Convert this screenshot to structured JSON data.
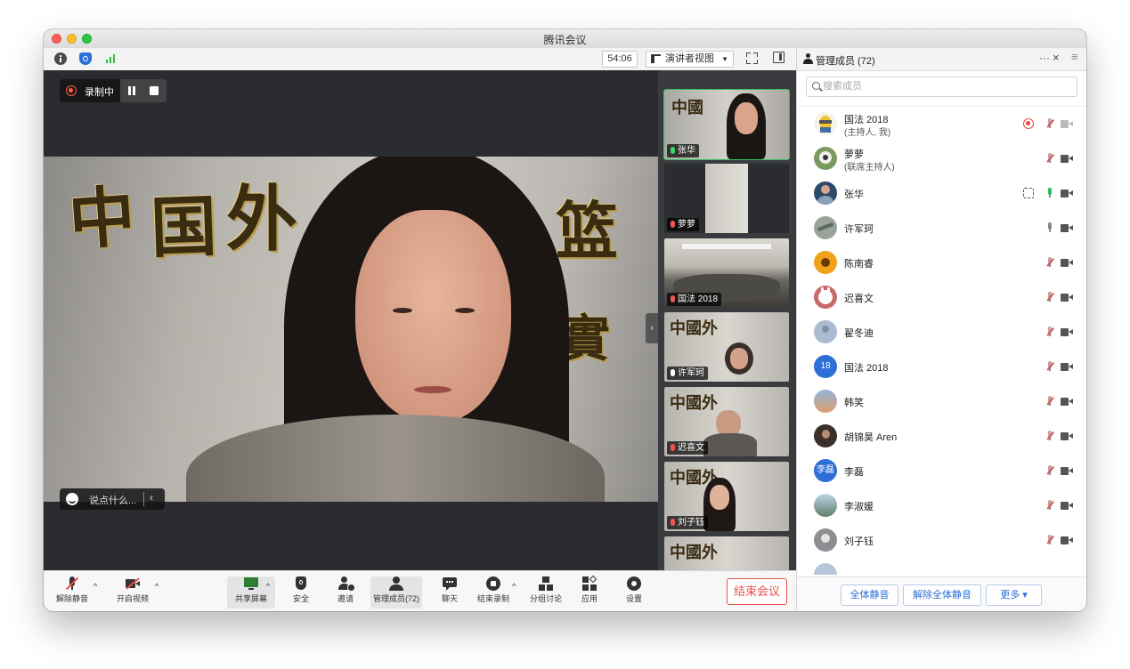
{
  "window": {
    "title": "腾讯会议"
  },
  "toolbar": {
    "timer": "54:06",
    "view_label": "演讲者视图",
    "view_caret": "▼"
  },
  "recording": {
    "label": "录制中"
  },
  "chat": {
    "placeholder": "说点什么...",
    "collapse_glyph": "‹"
  },
  "gallery": {
    "collapse_glyph": "›",
    "tiles": [
      {
        "name": "张华"
      },
      {
        "name": "萝萝"
      },
      {
        "name": "国法 2018"
      },
      {
        "name": "许军珂"
      },
      {
        "name": "迟喜文"
      },
      {
        "name": "刘子钰"
      }
    ]
  },
  "bottombar": {
    "unmute": "解除静音",
    "start_video": "开启视频",
    "share_screen": "共享屏幕",
    "security": "安全",
    "invite": "邀请",
    "manage_members": "管理成员(72)",
    "chat": "聊天",
    "end_record": "结束录制",
    "breakout": "分组讨论",
    "apps": "应用",
    "settings": "设置",
    "end_meeting": "结束会议",
    "caret": "^"
  },
  "panel": {
    "title": "管理成员 (72)",
    "more": "···",
    "close": "×",
    "menu": "≡",
    "search_placeholder": "搜索成员",
    "members": [
      {
        "name": "国法 2018",
        "role": "(主持人, 我)"
      },
      {
        "name": "萝萝",
        "role": "(联席主持人)"
      },
      {
        "name": "张华",
        "role": ""
      },
      {
        "name": "许军珂",
        "role": ""
      },
      {
        "name": "陈南睿",
        "role": ""
      },
      {
        "name": "迟喜文",
        "role": ""
      },
      {
        "name": "翟冬迪",
        "role": ""
      },
      {
        "name": "国法 2018",
        "role": "",
        "avatar_text": "18"
      },
      {
        "name": "韩笑",
        "role": ""
      },
      {
        "name": "胡锦昊 Aren",
        "role": ""
      },
      {
        "name": "李磊",
        "role": "",
        "avatar_text": "李磊"
      },
      {
        "name": "李淑媛",
        "role": ""
      },
      {
        "name": "刘子钰",
        "role": ""
      }
    ],
    "footer": {
      "mute_all": "全体静音",
      "unmute_all": "解除全体静音",
      "more": "更多 ▾"
    }
  },
  "colors": {
    "accent_blue": "#2d6fd6",
    "danger_red": "#e8504a",
    "active_green": "#2bc45a"
  }
}
